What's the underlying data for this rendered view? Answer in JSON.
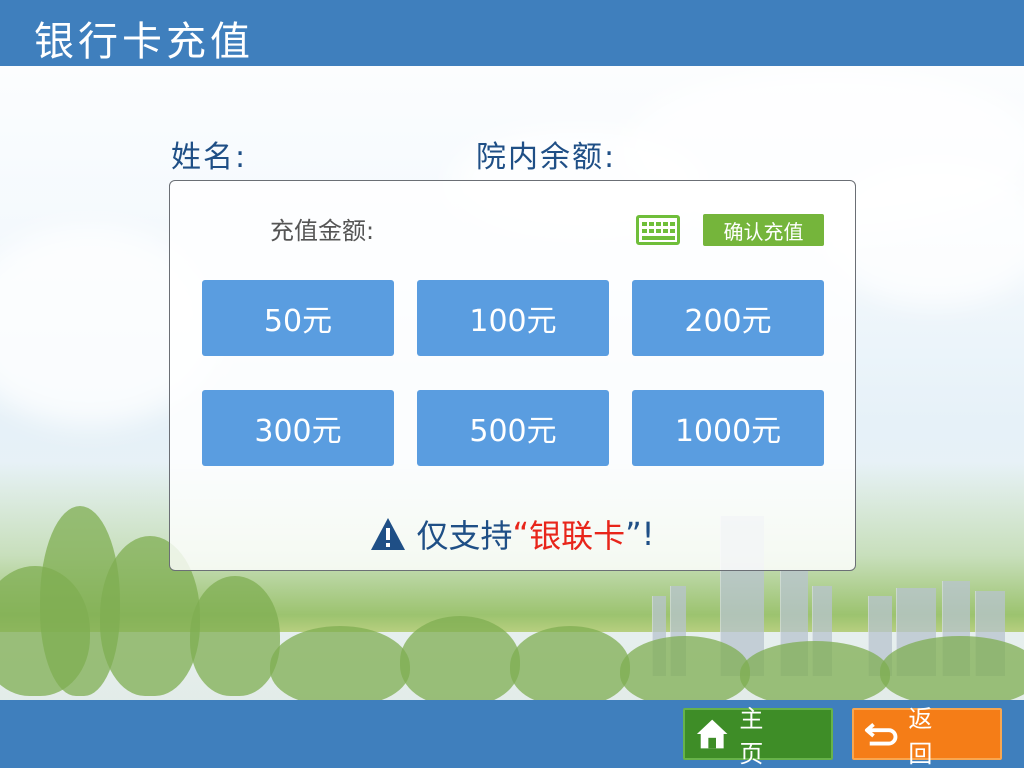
{
  "header": {
    "title": "银行卡充值"
  },
  "info": {
    "name_label": "姓名:",
    "balance_label": "院内余额:"
  },
  "panel": {
    "amount_label": "充值金额:",
    "keyboard_icon": "keyboard-icon",
    "confirm_label": "确认充值",
    "amounts": [
      "50元",
      "100元",
      "200元",
      "300元",
      "500元",
      "1000元"
    ],
    "notice": {
      "prefix": "仅支持",
      "open_quote": "“",
      "highlight": "银联卡",
      "close_quote": "”!"
    }
  },
  "footer": {
    "home_label": "主页",
    "back_label": "返回"
  },
  "colors": {
    "header": "#3f7fbd",
    "amount_button": "#5a9de0",
    "confirm": "#75b53b",
    "home": "#3e8d27",
    "back": "#f57d17",
    "warning": "#e8251a"
  }
}
